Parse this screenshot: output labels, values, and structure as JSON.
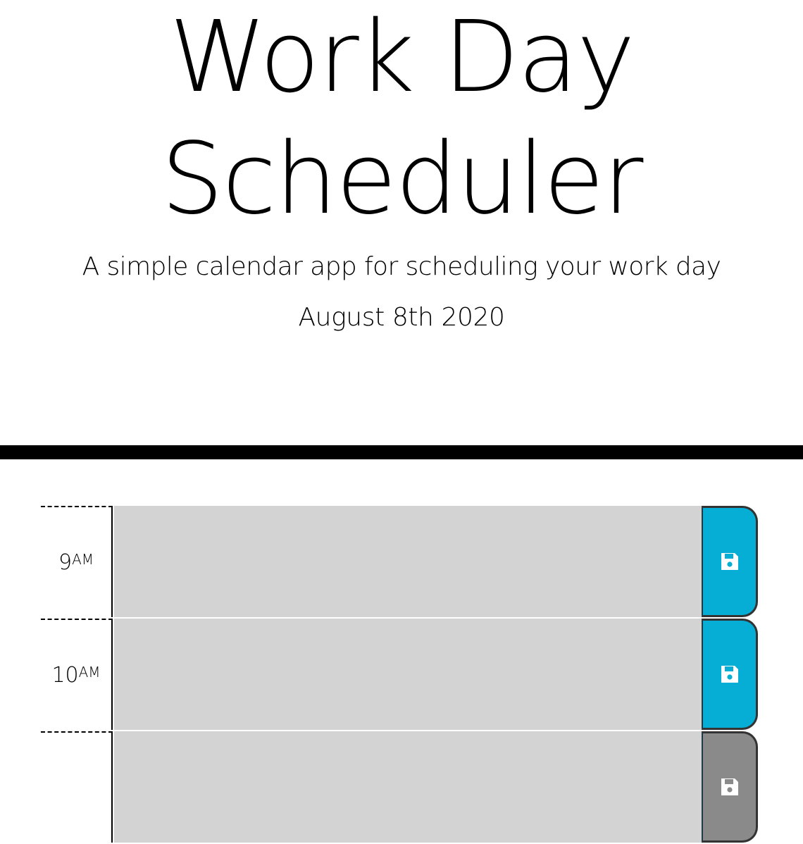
{
  "header": {
    "title_line_1": "Work Day",
    "title_line_2": "Scheduler",
    "subtitle": "A simple calendar app for scheduling your work day",
    "current_day": "August 8th 2020"
  },
  "colors": {
    "save_button": "#06aed5",
    "description_bg": "#d3d3d3",
    "divider": "#000000"
  },
  "schedule": {
    "rows": [
      {
        "hour": "9",
        "period": "AM",
        "description": "",
        "save_icon": "floppy-disk-icon"
      },
      {
        "hour": "10",
        "period": "AM",
        "description": "",
        "save_icon": "floppy-disk-icon"
      },
      {
        "hour": "",
        "period": "",
        "description": "",
        "save_icon": "floppy-disk-icon"
      }
    ]
  }
}
